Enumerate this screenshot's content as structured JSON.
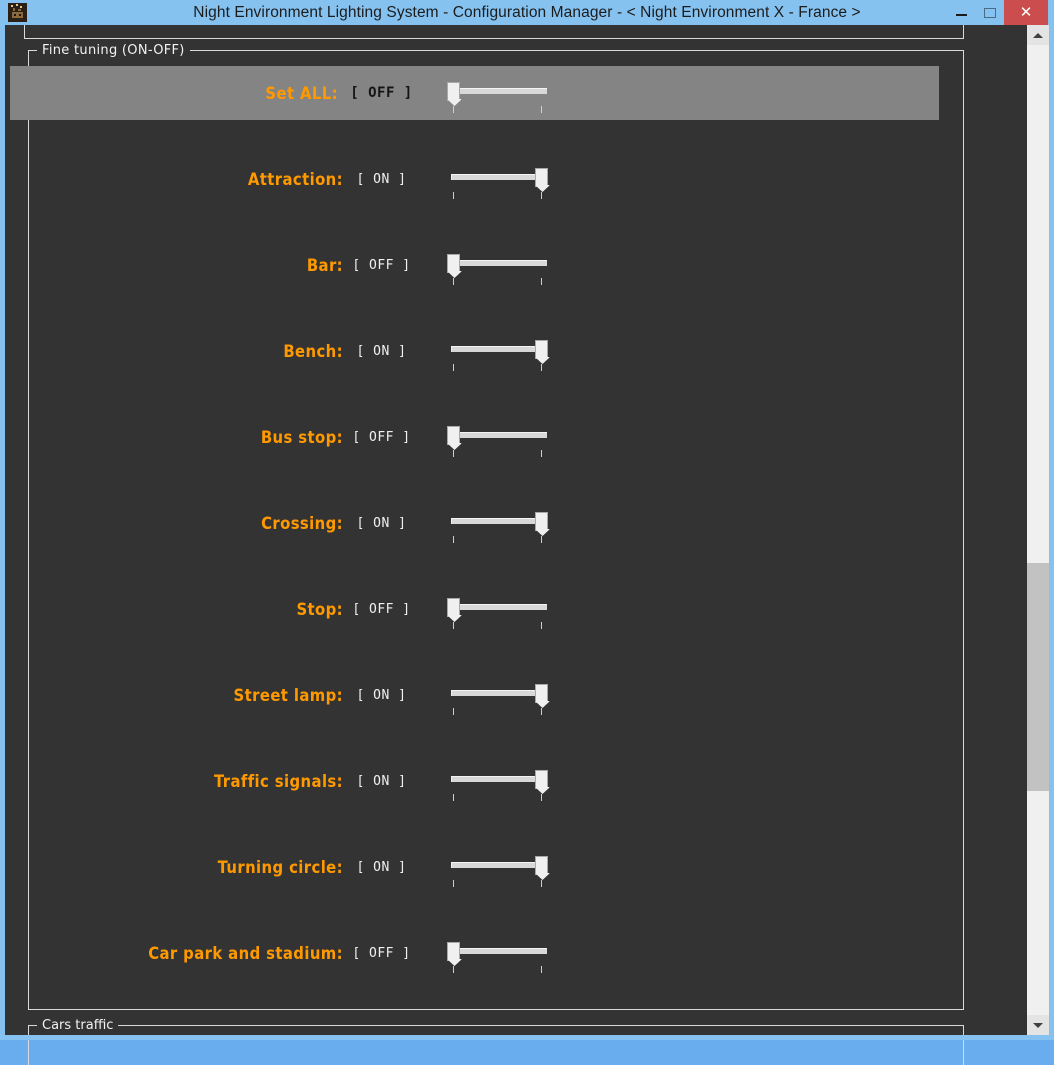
{
  "window": {
    "title": "Night Environment Lighting System - Configuration Manager - < Night Environment X - France >",
    "icon_name": "app-icon",
    "minimize_label": "–",
    "maximize_label": "□",
    "close_label": "✕",
    "accent_titlebar_color": "#85c2f0",
    "close_button_color": "#cc4d4d",
    "client_background_color": "#333333"
  },
  "top_partial_group": {
    "legend": ""
  },
  "fine_tuning": {
    "legend": "Fine tuning (ON-OFF)",
    "label_color": "#ff9900",
    "state_color": "#f0f0f0",
    "highlight_background": "#848484",
    "rows": [
      {
        "label": "Set ALL:",
        "state": "[ OFF ]",
        "value": "OFF",
        "highlighted": true
      },
      {
        "label": "Attraction:",
        "state": "[ ON ]",
        "value": "ON",
        "highlighted": false
      },
      {
        "label": "Bar:",
        "state": "[ OFF ]",
        "value": "OFF",
        "highlighted": false
      },
      {
        "label": "Bench:",
        "state": "[ ON ]",
        "value": "ON",
        "highlighted": false
      },
      {
        "label": "Bus stop:",
        "state": "[ OFF ]",
        "value": "OFF",
        "highlighted": false
      },
      {
        "label": "Crossing:",
        "state": "[ ON ]",
        "value": "ON",
        "highlighted": false
      },
      {
        "label": "Stop:",
        "state": "[ OFF ]",
        "value": "OFF",
        "highlighted": false
      },
      {
        "label": "Street lamp:",
        "state": "[ ON ]",
        "value": "ON",
        "highlighted": false
      },
      {
        "label": "Traffic signals:",
        "state": "[ ON ]",
        "value": "ON",
        "highlighted": false
      },
      {
        "label": "Turning circle:",
        "state": "[ ON ]",
        "value": "ON",
        "highlighted": false
      },
      {
        "label": "Car park and stadium:",
        "state": "[ OFF ]",
        "value": "OFF",
        "highlighted": false
      }
    ]
  },
  "cars_traffic": {
    "legend": "Cars traffic"
  },
  "scrollbar": {
    "up_arrow": "up-arrow-icon",
    "down_arrow": "down-arrow-icon",
    "thumb": "scrollbar-thumb"
  }
}
